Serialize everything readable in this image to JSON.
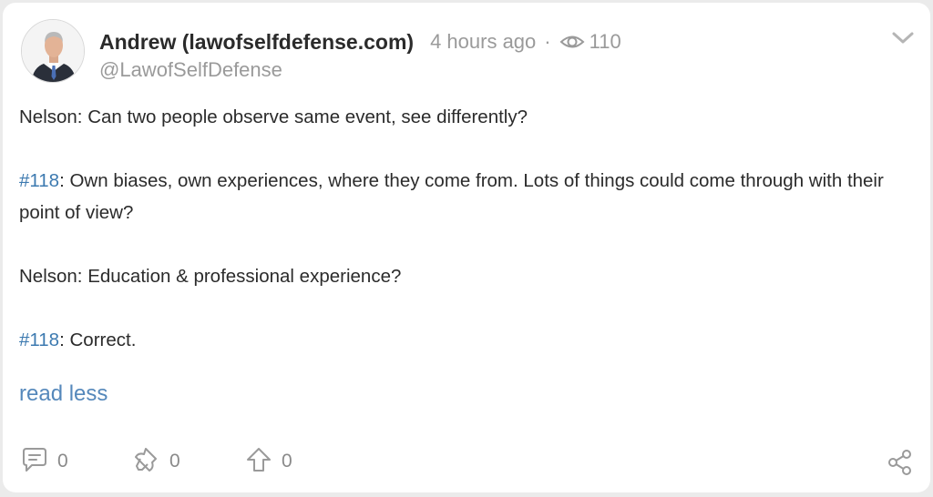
{
  "post": {
    "author_name": "Andrew (lawofselfdefense.com)",
    "timestamp": "4 hours ago",
    "separator": "·",
    "views": "110",
    "handle": "@LawofSelfDefense",
    "paragraphs": [
      {
        "prefix": "",
        "hashtag": "",
        "text": "Nelson: Can two people observe same event, see differently?"
      },
      {
        "prefix": "",
        "hashtag": "#118",
        "text": ": Own biases, own experiences, where they come from. Lots of things could come through with their point of view?"
      },
      {
        "prefix": "",
        "hashtag": "",
        "text": "Nelson: Education & professional experience?"
      },
      {
        "prefix": "",
        "hashtag": "#118",
        "text": ": Correct."
      }
    ],
    "read_less_label": "read less"
  },
  "actions": {
    "comments": "0",
    "remixes": "0",
    "upvotes": "0"
  },
  "icons": {
    "views": "eye-icon",
    "menu": "chevron-down-icon",
    "comment": "comment-icon",
    "remix": "remix-icon",
    "upvote": "upvote-arrow-icon",
    "share": "share-icon"
  },
  "colors": {
    "link": "#3d7ab0",
    "muted": "#9a9a9a",
    "text": "#2b2b2b"
  }
}
